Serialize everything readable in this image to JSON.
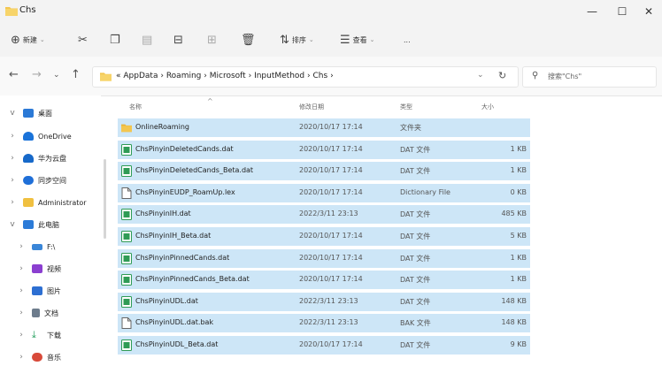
{
  "window": {
    "title": "Chs"
  },
  "toolbar": {
    "new_label": "新建",
    "sort_label": "排序",
    "view_label": "查看",
    "more_label": "..."
  },
  "address": {
    "breadcrumbs": [
      "«",
      "AppData",
      "›",
      "Roaming",
      "›",
      "Microsoft",
      "›",
      "InputMethod",
      "›",
      "Chs",
      "›"
    ],
    "search_placeholder": "搜索\"Chs\""
  },
  "sidebar": {
    "items": [
      {
        "label": "桌面",
        "arrow": "v",
        "color": "#2b79d6"
      },
      {
        "label": "OneDrive",
        "arrow": "›",
        "color": "#1a73d9"
      },
      {
        "label": "华为云盘",
        "arrow": "›",
        "color": "#1769c9"
      },
      {
        "label": "同步空间",
        "arrow": "›",
        "color": "#1f6fd8"
      },
      {
        "label": "Administrator",
        "arrow": "›",
        "color": "#f0c040"
      },
      {
        "label": "此电脑",
        "arrow": "v",
        "color": "#2c7bd8"
      },
      {
        "label": "F:\\",
        "arrow": "›",
        "color": "#3a86d8"
      },
      {
        "label": "视频",
        "arrow": "›",
        "color": "#8b3fd0"
      },
      {
        "label": "图片",
        "arrow": "›",
        "color": "#2d6fd2"
      },
      {
        "label": "文档",
        "arrow": "›",
        "color": "#6d7c8c"
      },
      {
        "label": "下载",
        "arrow": "›",
        "color": "#1f9d5a"
      },
      {
        "label": "音乐",
        "arrow": "›",
        "color": "#d84a3a"
      }
    ]
  },
  "columns": {
    "name": "名称",
    "date": "修改日期",
    "type": "类型",
    "size": "大小"
  },
  "files": [
    {
      "name": "OnlineRoaming",
      "date": "2020/10/17 17:14",
      "type": "文件夹",
      "size": "",
      "kind": "folder"
    },
    {
      "name": "ChsPinyinDeletedCands.dat",
      "date": "2020/10/17 17:14",
      "type": "DAT 文件",
      "size": "1 KB",
      "kind": "dat"
    },
    {
      "name": "ChsPinyinDeletedCands_Beta.dat",
      "date": "2020/10/17 17:14",
      "type": "DAT 文件",
      "size": "1 KB",
      "kind": "dat"
    },
    {
      "name": "ChsPinyinEUDP_RoamUp.lex",
      "date": "2020/10/17 17:14",
      "type": "Dictionary File",
      "size": "0 KB",
      "kind": "doc"
    },
    {
      "name": "ChsPinyinIH.dat",
      "date": "2022/3/11 23:13",
      "type": "DAT 文件",
      "size": "485 KB",
      "kind": "dat"
    },
    {
      "name": "ChsPinyinIH_Beta.dat",
      "date": "2020/10/17 17:14",
      "type": "DAT 文件",
      "size": "5 KB",
      "kind": "dat"
    },
    {
      "name": "ChsPinyinPinnedCands.dat",
      "date": "2020/10/17 17:14",
      "type": "DAT 文件",
      "size": "1 KB",
      "kind": "dat"
    },
    {
      "name": "ChsPinyinPinnedCands_Beta.dat",
      "date": "2020/10/17 17:14",
      "type": "DAT 文件",
      "size": "1 KB",
      "kind": "dat"
    },
    {
      "name": "ChsPinyinUDL.dat",
      "date": "2022/3/11 23:13",
      "type": "DAT 文件",
      "size": "148 KB",
      "kind": "dat"
    },
    {
      "name": "ChsPinyinUDL.dat.bak",
      "date": "2022/3/11 23:13",
      "type": "BAK 文件",
      "size": "148 KB",
      "kind": "doc"
    },
    {
      "name": "ChsPinyinUDL_Beta.dat",
      "date": "2020/10/17 17:14",
      "type": "DAT 文件",
      "size": "9 KB",
      "kind": "dat"
    }
  ],
  "colors": {
    "selection": "#cde6f7",
    "folder": "#f3c64f",
    "dat_icon": "#2f9b55",
    "accent": "#0067c0"
  }
}
